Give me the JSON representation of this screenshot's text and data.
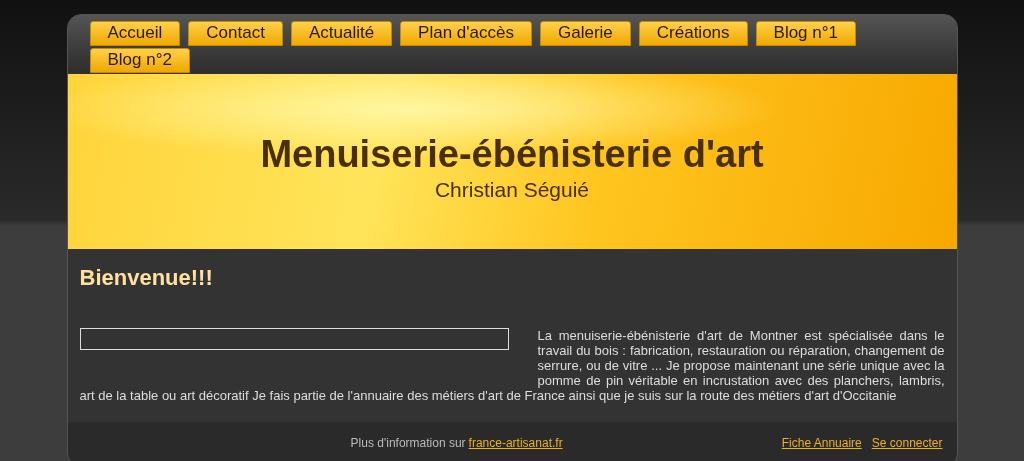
{
  "menu": [
    {
      "label": "Accueil"
    },
    {
      "label": "Contact"
    },
    {
      "label": "Actualité"
    },
    {
      "label": "Plan d'accès"
    },
    {
      "label": "Galerie"
    },
    {
      "label": "Créations"
    },
    {
      "label": "Blog n°1"
    },
    {
      "label": "Blog n°2"
    }
  ],
  "header": {
    "title": "Menuiserie-ébénisterie d'art",
    "subtitle": "Christian Séguié"
  },
  "content": {
    "heading": "Bienvenue!!!",
    "text": "La menuiserie-ébénisterie d'art de Montner est spécialisée dans le travail du bois : fabrication, restauration ou réparation, changement de serrure, ou de vitre ... Je propose maintenant une série unique avec la pomme de pin véritable en incrustation avec des planchers, lambris,",
    "text_continued": "art de la table ou art décoratif Je fais partie de l'annuaire des métiers d'art de France ainsi que je suis sur la route des métiers d'art d'Occitanie"
  },
  "footer": {
    "info": "Plus d'information sur",
    "info_link": "france-artisanat.fr",
    "links": [
      {
        "label": "Fiche Annuaire"
      },
      {
        "label": "Se connecter"
      }
    ]
  }
}
